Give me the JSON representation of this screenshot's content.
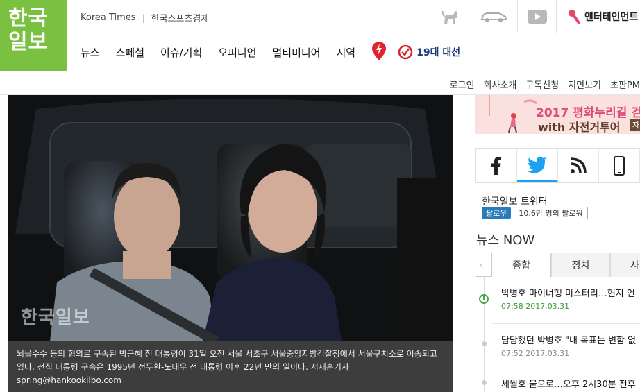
{
  "logo": {
    "line1": "한국",
    "line2": "일보"
  },
  "top_links": [
    "Korea Times",
    "한국스포츠경제"
  ],
  "top_icons": [
    "dog-icon",
    "car-icon",
    "play-icon",
    "microphone-icon"
  ],
  "entertainment_label": "엔터테인먼트",
  "nav": {
    "items": [
      "뉴스",
      "스페셜",
      "이슈/기획",
      "오피니언",
      "멀티미디어",
      "지역"
    ],
    "election_label": "19대 대선"
  },
  "util_links": [
    "로그인",
    "회사소개",
    "구독신청",
    "지면보기",
    "초판PM"
  ],
  "photo": {
    "watermark": "한국일보",
    "caption": "뇌물수수 등의 혐의로 구속된 박근혜 전 대통령이 31일 오전 서울 서초구 서울중앙지방검찰청에서 서울구치소로 이송되고 있다. 전직 대통령 구속은 1995년 전두환-노태우 전 대통령 이후 22년 만의 일이다. 서재훈기자 spring@hankookilbo.com"
  },
  "banner": {
    "line1": "2017 평화누리길 걷",
    "line2": "with 자전거투어",
    "badge": "자"
  },
  "social": {
    "twitter_label": "한국일보 트위터",
    "follow_label": "팔로우",
    "follower_count": "10.6만 명의 팔로워"
  },
  "news_now": {
    "title": "뉴스 NOW",
    "tabs": [
      "종합",
      "정치",
      "사"
    ],
    "items": [
      {
        "title": "박병호 마이너행 미스터리…현지 언",
        "time": "07:58 2017.03.31"
      },
      {
        "title": "담담했던 박병호 \"내 목표는 변함 없",
        "time": "07:52 2017.03.31"
      },
      {
        "title": "세월호 뭍으로…오후 2시30분 전후",
        "time": ""
      }
    ]
  },
  "colors": {
    "brand_green": "#7ac142",
    "twitter_blue": "#1da1f2",
    "caption_bg": "#3d3d3d"
  }
}
